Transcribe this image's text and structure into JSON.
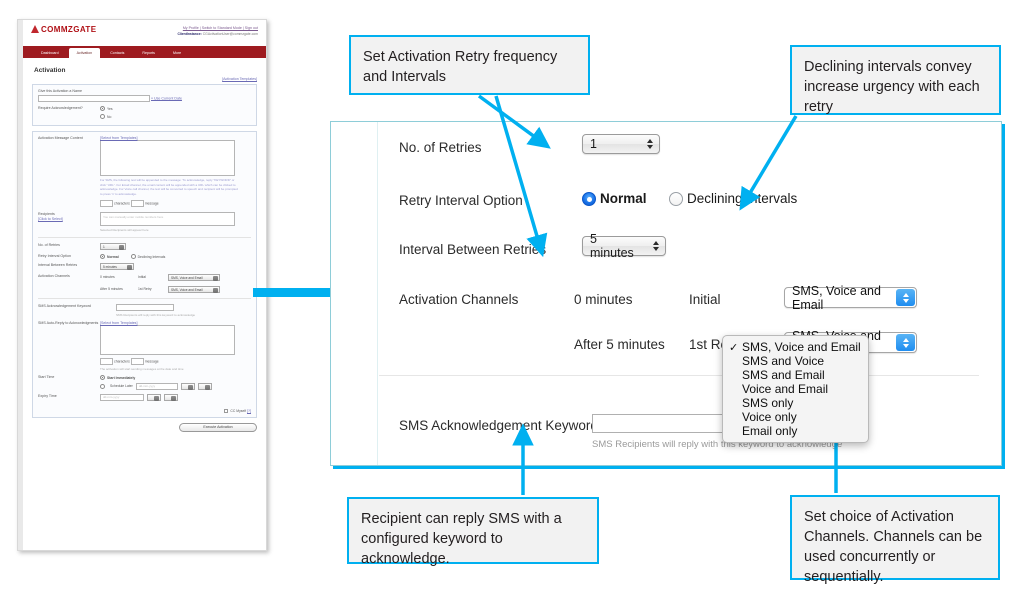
{
  "thumbnail": {
    "name": "activation-form-screenshot",
    "brand": "COMMZGATE",
    "top_links": "My Profile | Switch to Standard Mode | Sign out",
    "user_label": "ClientInstance:",
    "user_value": "CGActivationUser@commzgate.com",
    "tabs": [
      "Dashboard",
      "Activation",
      "Contacts",
      "Reports",
      "More"
    ],
    "active_tab": "Activation",
    "page_title": "Activation",
    "templates_link": "[Activation Templates]",
    "fields": {
      "name_label": "Give this Activation a Name",
      "use_current_date": "» Use Current Date",
      "ack_label": "Require Acknowledgement?",
      "ack_yes": "Yes",
      "ack_no": "No",
      "message_label": "Activation Message Content",
      "select_template": "[Select from Templates]",
      "message_help": "For SMS, the following text will be appended to the message: 'To acknowledge, reply \"KEYWORD\" or click \"URL\". For Email channel, the email content will be appended with a URL which can be clicked to acknowledge. For Voice call channel, the text will be converted to speech and recipient will be prompted to press '1' to acknowledge.",
      "chars_value": "0",
      "chars_label": "characters",
      "msgs_value": "1",
      "msgs_label": "message",
      "recipients_label": "Recipients",
      "recipients_link": "[Click to Select]",
      "recipients_placeholder": "You can manually enter mobile numbers here",
      "recipients_note": "Selected Recipients will appear here",
      "retries_label": "No. of Retries",
      "retries_value": "1",
      "retry_option_label": "Retry Interval Option",
      "normal": "Normal",
      "declining": "Declining Intervals",
      "interval_label": "Interval Between Retries",
      "interval_value": "5 minutes",
      "channels_label": "Activation Channels",
      "ch_time_0": "0 minutes",
      "ch_stage_0": "Initial",
      "ch_value_0": "SMS, Voice and Email",
      "ch_time_1": "After 5 minutes",
      "ch_stage_1": "1st Retry",
      "ch_value_1": "SMS, Voice and Email",
      "keyword_label": "SMS Acknowledgement Keyword",
      "keyword_hint": "SMS Recipients will reply with this keyword to acknowledge",
      "autoreply_label": "SMS Auto-Reply to Acknowledgments",
      "autoreply_template": "[Select from Templates]",
      "start_time_label": "Start Time",
      "start_immediately": "Start Immediately",
      "schedule_later": "Schedule Later",
      "schedule_value": "dd-mm-yyyy",
      "start_note": "The activation will start sending messages at the date and time",
      "expiry_label": "Expiry Time",
      "expiry_value": "dd-mm-yyyy",
      "cc_myself": "CC Myself",
      "cc_help": "[?]",
      "execute_button": "Execute Activation"
    }
  },
  "panel": {
    "name": "activation-retry-settings-panel",
    "rows": {
      "retries_label": "No. of Retries",
      "retries_value": "1",
      "retry_option_label": "Retry Interval Option",
      "normal_label": "Normal",
      "declining_label": "Declining Intervals",
      "interval_label": "Interval Between Retries",
      "interval_value": "5 minutes",
      "channels_label": "Activation Channels",
      "channel_rows": [
        {
          "time": "0 minutes",
          "stage": "Initial",
          "value": "SMS, Voice and Email"
        },
        {
          "time": "After 5 minutes",
          "stage": "1st Retry",
          "value": "SMS, Voice and Email"
        }
      ],
      "keyword_label": "SMS Acknowledgement Keyword",
      "keyword_value": "",
      "keyword_placeholder": "",
      "keyword_hint": "SMS Recipients will reply with this keyword to acknowledge"
    },
    "dropdown": {
      "name": "activation-channels-dropdown",
      "selected": "SMS, Voice and Email",
      "check_glyph": "✓",
      "options": [
        "SMS, Voice and Email",
        "SMS and Voice",
        "SMS and Email",
        "Voice and Email",
        "SMS only",
        "Voice only",
        "Email only"
      ]
    }
  },
  "callouts": {
    "retry": "Set Activation Retry frequency and Intervals",
    "declining": "Declining intervals convey increase urgency with each retry",
    "keyword": "Recipient can reply SMS with a configured keyword to acknowledge.",
    "channels": "Set choice of Activation Channels. Channels can be used concurrently or sequentially."
  },
  "colors": {
    "accent": "#00b0f0",
    "panel_border": "#8ecdd8",
    "brand_red": "#9e1b20",
    "radio_blue": "#1a73e8",
    "callout_bg": "#f2f2f2"
  }
}
